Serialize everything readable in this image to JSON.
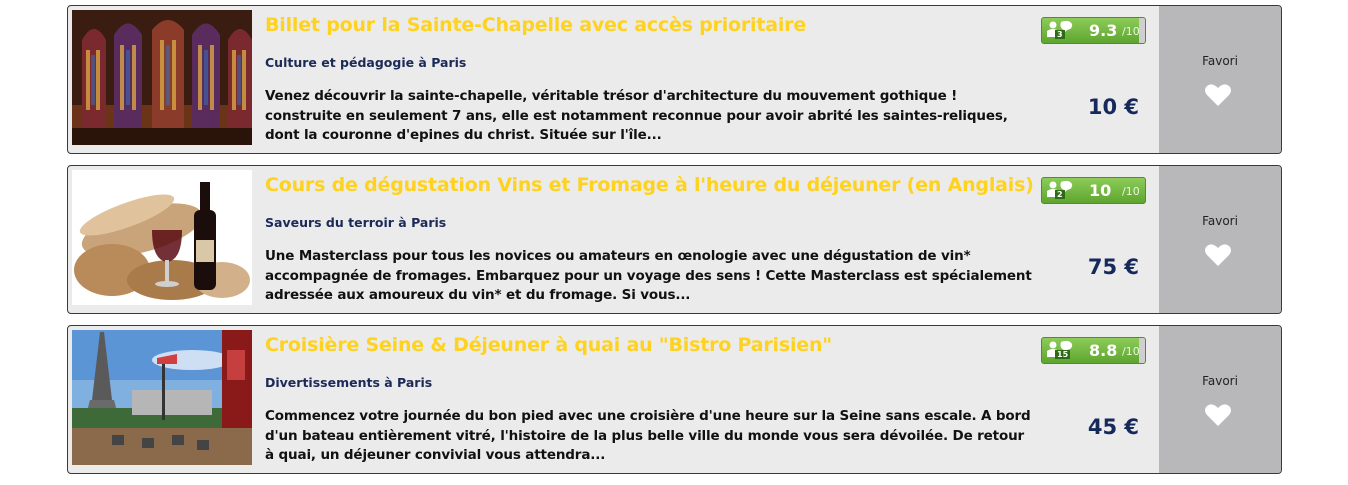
{
  "listings": [
    {
      "title": "Billet pour la Sainte-Chapelle avec accès prioritaire",
      "category": "Culture et pédagogie à Paris",
      "description": "Venez découvrir la sainte-chapelle, véritable trésor d'architecture du mouvement gothique !  construite en seulement 7 ans, elle est notamment reconnue pour avoir abrité les saintes-reliques, dont la couronne d'epines du christ. Située sur l'île...",
      "rating": {
        "count": "3",
        "score": "9.3",
        "scale": "/10"
      },
      "price": "10 €",
      "favorite_label": "Favori",
      "image": "sainte-chapelle-stained-glass"
    },
    {
      "title": "Cours de dégustation Vins et Fromage à l'heure du déjeuner (en Anglais)",
      "category": "Saveurs du terroir à Paris",
      "description": "Une Masterclass pour tous les novices ou amateurs en œnologie avec une dégustation de vin* accompagnée de fromages. Embarquez pour un voyage des sens !   Cette Masterclass est spécialement adressée aux amoureux du vin* et du fromage. Si vous...",
      "rating": {
        "count": "2",
        "score": "10",
        "scale": "/10"
      },
      "price": "75 €",
      "favorite_label": "Favori",
      "image": "bread-wine-cheese"
    },
    {
      "title": "Croisière Seine & Déjeuner à quai au \"Bistro Parisien\"",
      "category": "Divertissements à Paris",
      "description": "Commencez votre journée du bon pied avec une croisière d'une heure sur la Seine sans escale. A bord d'un bateau entièrement vitré, l'histoire de la plus belle ville du monde vous sera dévoilée. De retour à quai, un déjeuner convivial vous attendra...",
      "rating": {
        "count": "15",
        "score": "8.8",
        "scale": "/10"
      },
      "price": "45 €",
      "favorite_label": "Favori",
      "image": "eiffel-tower-terrace"
    }
  ],
  "colors": {
    "title": "#ffd21f",
    "category": "#1b2a57",
    "price": "#16295c",
    "rating_green": "#6fb63d",
    "favorite_panel": "#b8b8bb",
    "card_bg": "#ebebeb"
  }
}
